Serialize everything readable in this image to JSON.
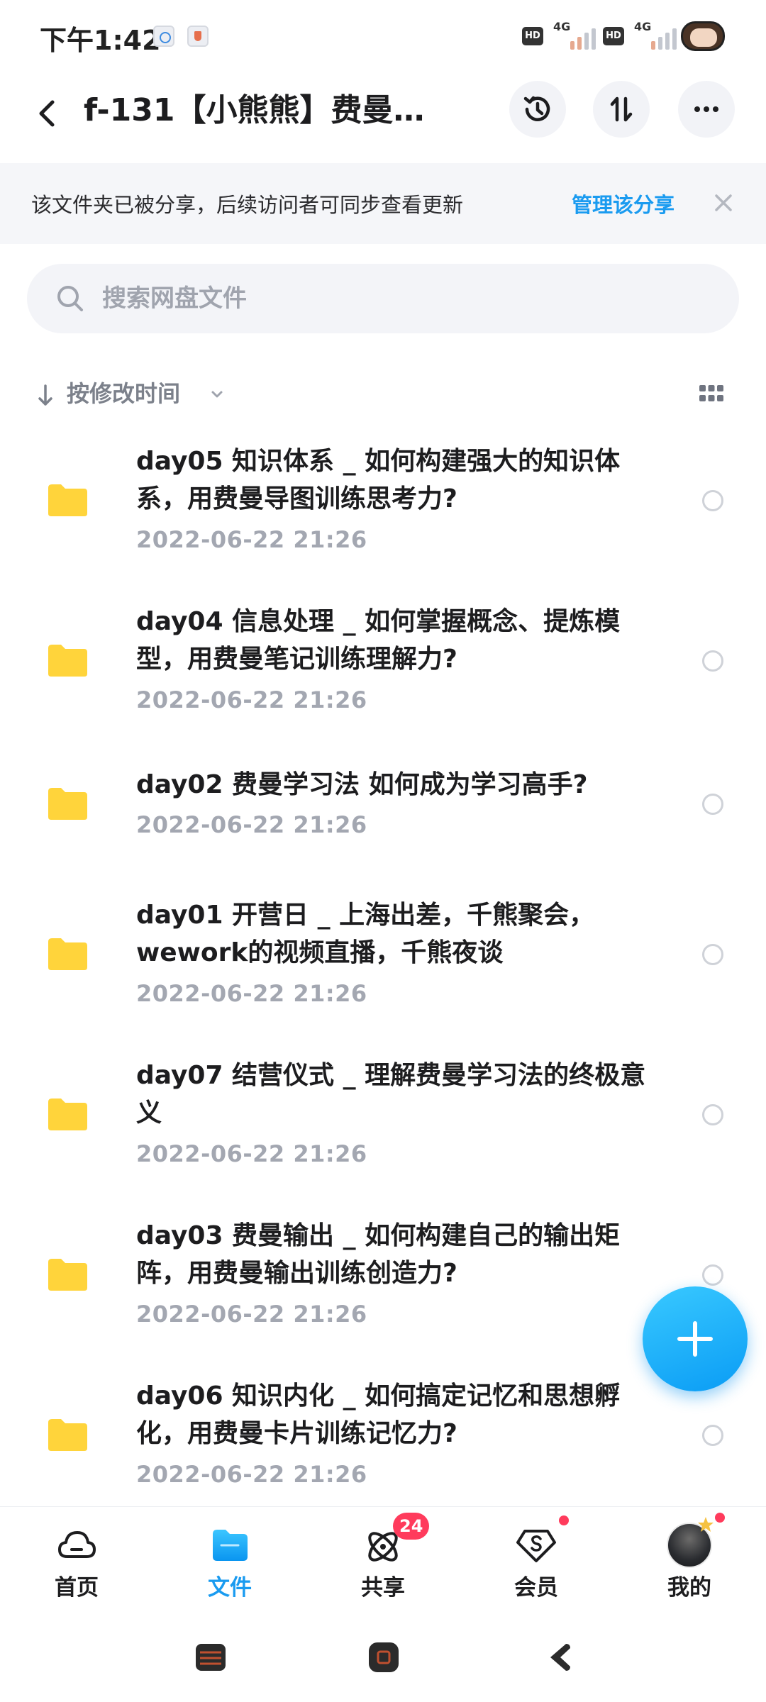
{
  "status_bar": {
    "time": "下午1:42",
    "network_badge_1": "HD",
    "network_gen_1": "4G",
    "network_badge_2": "HD",
    "network_gen_2": "4G"
  },
  "header": {
    "title": "f-131【小熊熊】费曼学..."
  },
  "share_banner": {
    "text": "该文件夹已被分享，后续访问者可同步查看更新",
    "link": "管理该分享"
  },
  "search": {
    "placeholder": "搜索网盘文件"
  },
  "sort": {
    "label": "按修改时间"
  },
  "files": [
    {
      "name": "day05 知识体系 _ 如何构建强大的知识体系，用费曼导图训练思考力?",
      "date": "2022-06-22  21:26"
    },
    {
      "name": "day04 信息处理 _ 如何掌握概念、提炼模型，用费曼笔记训练理解力?",
      "date": "2022-06-22  21:26"
    },
    {
      "name": "day02 费曼学习法  如何成为学习高手?",
      "date": "2022-06-22  21:26"
    },
    {
      "name": "day01 开营日 _ 上海出差，千熊聚会，wework的视频直播，千熊夜谈",
      "date": "2022-06-22  21:26"
    },
    {
      "name": "day07 结营仪式 _ 理解费曼学习法的终极意义",
      "date": "2022-06-22  21:26"
    },
    {
      "name": "day03 费曼输出 _ 如何构建自己的输出矩阵，用费曼输出训练创造力?",
      "date": "2022-06-22  21:26"
    },
    {
      "name": "day06 知识内化 _ 如何搞定记忆和思想孵化，用费曼卡片训练记忆力?",
      "date": "2022-06-22  21:26"
    }
  ],
  "bottom_nav": {
    "items": [
      {
        "label": "首页",
        "icon": "cloud-home-icon"
      },
      {
        "label": "文件",
        "icon": "folder-icon"
      },
      {
        "label": "共享",
        "icon": "share-orbit-icon",
        "badge": "24"
      },
      {
        "label": "会员",
        "icon": "vip-diamond-icon"
      },
      {
        "label": "我的",
        "icon": "avatar"
      }
    ]
  },
  "colors": {
    "accent": "#1a9bf0",
    "folder": "#ffd43b",
    "badge": "#ff3b5c"
  }
}
